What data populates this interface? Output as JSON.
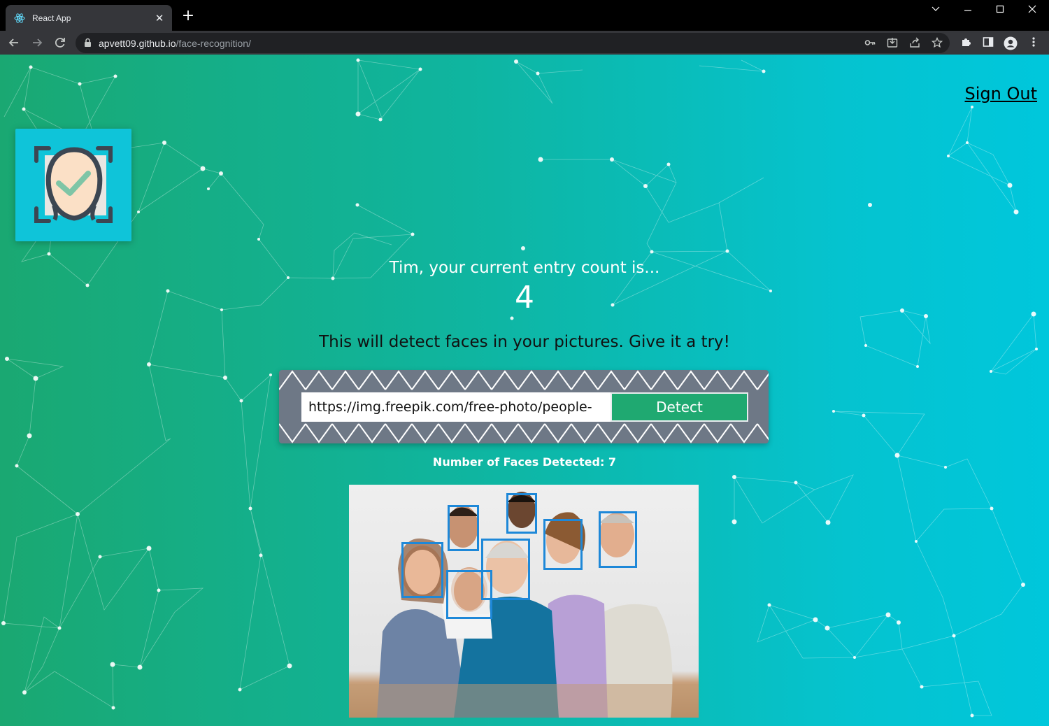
{
  "browser": {
    "tab_title": "React App",
    "url_host": "apvett09.github.io",
    "url_path": "/face-recognition/"
  },
  "header": {
    "sign_out_label": "Sign Out"
  },
  "main": {
    "entry_text": "Tim, your current entry count is...",
    "entry_count": "4",
    "description": "This will detect faces in your pictures. Give it a try!",
    "input_value": "https://img.freepik.com/free-photo/people-",
    "detect_label": "Detect",
    "faces_detected_text": "Number of Faces Detected: 7"
  },
  "colors": {
    "gradient_start": "#1aa871",
    "gradient_end": "#00c7dc",
    "detect_button": "#1fa971",
    "face_box": "#1e88d8",
    "logo_card": "#0fc4d9"
  }
}
